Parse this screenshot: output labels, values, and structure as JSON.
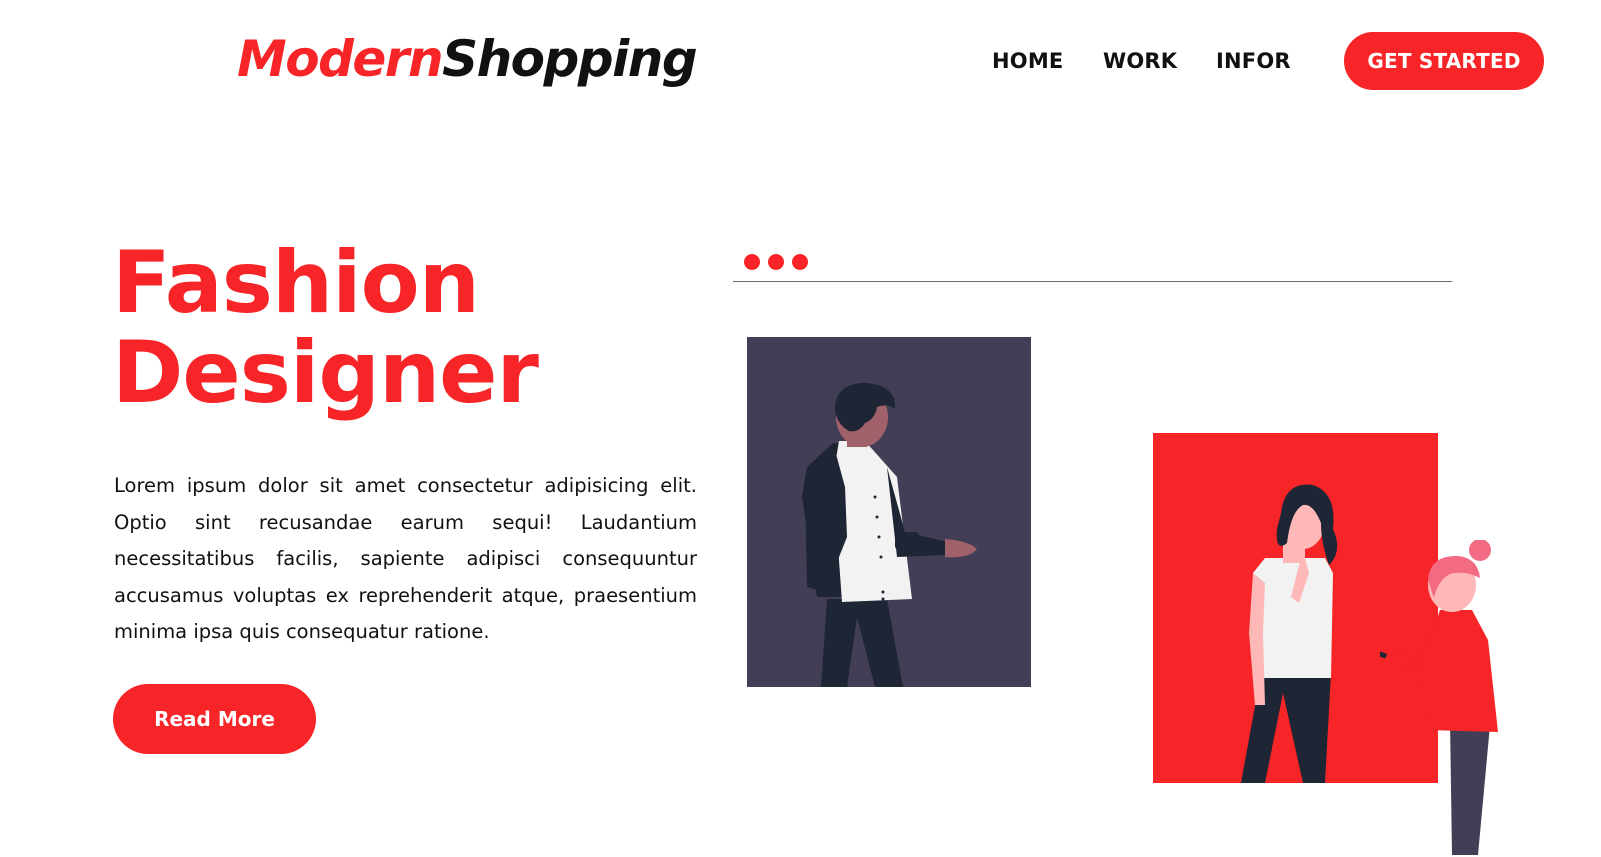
{
  "header": {
    "logo_part1": "Modern",
    "logo_part2": "Shopping",
    "nav": [
      "HOME",
      "WORK",
      "INFOR"
    ],
    "cta_label": "GET STARTED"
  },
  "hero": {
    "title_line1": "Fashion",
    "title_line2": "Designer",
    "body": "Lorem ipsum dolor sit amet consectetur adipisicing elit. Optio sint recusandae earum sequi! Laudantium necessitatibus facilis, sapiente adipisci consequuntur accusamus voluptas ex reprehenderit atque, praesentium minima ipsa quis consequatur ratione.",
    "read_more_label": "Read More"
  },
  "colors": {
    "accent": "#f72527",
    "text": "#111111",
    "card_dark": "#423e56",
    "figure_dark": "#1e2535",
    "skin_dark": "#a0616a",
    "skin_light": "#ffb8b8"
  },
  "icons": [
    "window-dots-icon"
  ]
}
